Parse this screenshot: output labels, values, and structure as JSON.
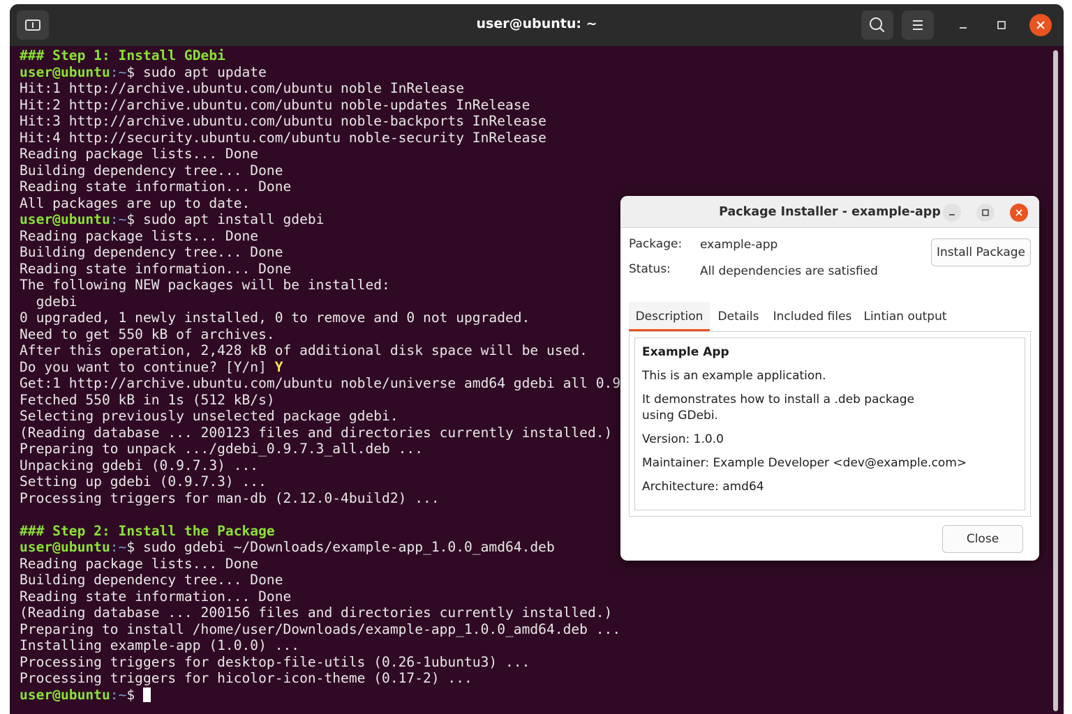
{
  "window": {
    "title": "user@ubuntu: ~",
    "icons": {
      "new_tab": "new-tab-icon",
      "search": "search-icon",
      "menu": "hamburger-menu-icon"
    }
  },
  "colors": {
    "terminal_bg": "#300a24",
    "prompt_user": "#8ae234",
    "prompt_path": "#729fcf",
    "close_accent": "#e95420"
  },
  "terminal": {
    "lines": [
      {
        "t": "heading",
        "text": "### Step 1: Install GDebi"
      },
      {
        "t": "prompt",
        "user": "user@ubuntu",
        "path": ":~",
        "cmd": "$ sudo apt update"
      },
      {
        "t": "out",
        "text": "Hit:1 http://archive.ubuntu.com/ubuntu noble InRelease"
      },
      {
        "t": "out",
        "text": "Hit:2 http://archive.ubuntu.com/ubuntu noble-updates InRelease"
      },
      {
        "t": "out",
        "text": "Hit:3 http://archive.ubuntu.com/ubuntu noble-backports InRelease"
      },
      {
        "t": "out",
        "text": "Hit:4 http://security.ubuntu.com/ubuntu noble-security InRelease"
      },
      {
        "t": "out",
        "text": "Reading package lists... Done"
      },
      {
        "t": "out",
        "text": "Building dependency tree... Done"
      },
      {
        "t": "out",
        "text": "Reading state information... Done"
      },
      {
        "t": "out",
        "text": "All packages are up to date."
      },
      {
        "t": "prompt",
        "user": "user@ubuntu",
        "path": ":~",
        "cmd": "$ sudo apt install gdebi"
      },
      {
        "t": "out",
        "text": "Reading package lists... Done"
      },
      {
        "t": "out",
        "text": "Building dependency tree... Done"
      },
      {
        "t": "out",
        "text": "Reading state information... Done"
      },
      {
        "t": "out",
        "text": "The following NEW packages will be installed:"
      },
      {
        "t": "out",
        "text": "  gdebi"
      },
      {
        "t": "out",
        "text": "0 upgraded, 1 newly installed, 0 to remove and 0 not upgraded."
      },
      {
        "t": "out",
        "text": "Need to get 550 kB of archives."
      },
      {
        "t": "out",
        "text": "After this operation, 2,428 kB of additional disk space will be used."
      },
      {
        "t": "yn",
        "text": "Do you want to continue? [Y/n] ",
        "answer": "Y"
      },
      {
        "t": "out",
        "text": "Get:1 http://archive.ubuntu.com/ubuntu noble/universe amd64 gdebi all 0.9.7.3 [550 kB]"
      },
      {
        "t": "out",
        "text": "Fetched 550 kB in 1s (512 kB/s)"
      },
      {
        "t": "out",
        "text": "Selecting previously unselected package gdebi."
      },
      {
        "t": "out",
        "text": "(Reading database ... 200123 files and directories currently installed.)"
      },
      {
        "t": "out",
        "text": "Preparing to unpack .../gdebi_0.9.7.3_all.deb ..."
      },
      {
        "t": "out",
        "text": "Unpacking gdebi (0.9.7.3) ..."
      },
      {
        "t": "out",
        "text": "Setting up gdebi (0.9.7.3) ..."
      },
      {
        "t": "out",
        "text": "Processing triggers for man-db (2.12.0-4build2) ..."
      },
      {
        "t": "out",
        "text": ""
      },
      {
        "t": "heading",
        "text": "### Step 2: Install the Package"
      },
      {
        "t": "prompt",
        "user": "user@ubuntu",
        "path": ":~",
        "cmd": "$ sudo gdebi ~/Downloads/example-app_1.0.0_amd64.deb"
      },
      {
        "t": "out",
        "text": "Reading package lists... Done"
      },
      {
        "t": "out",
        "text": "Building dependency tree... Done"
      },
      {
        "t": "out",
        "text": "Reading state information... Done"
      },
      {
        "t": "out",
        "text": "(Reading database ... 200156 files and directories currently installed.)"
      },
      {
        "t": "out",
        "text": "Preparing to install /home/user/Downloads/example-app_1.0.0_amd64.deb ..."
      },
      {
        "t": "out",
        "text": "Installing example-app (1.0.0) ..."
      },
      {
        "t": "out",
        "text": "Processing triggers for desktop-file-utils (0.26-1ubuntu3) ..."
      },
      {
        "t": "out",
        "text": "Processing triggers for hicolor-icon-theme (0.17-2) ..."
      },
      {
        "t": "cursorprompt",
        "user": "user@ubuntu",
        "path": ":~",
        "cmd": "$ "
      }
    ]
  },
  "dialog": {
    "title": "Package Installer - example-app",
    "package_label": "Package:",
    "package_value": "example-app",
    "status_label": "Status:",
    "status_value": "All dependencies are satisfied",
    "install_button": "Install Package",
    "tabs": [
      "Description",
      "Details",
      "Included files",
      "Lintian output"
    ],
    "active_tab": "Description",
    "content": {
      "name": "Example App",
      "summary": "This is an example application.",
      "desc1": "It demonstrates how to install a .deb package",
      "desc2": "using GDebi.",
      "version": "Version: 1.0.0",
      "maintainer": "Maintainer: Example Developer <dev@example.com>",
      "architecture": "Architecture: amd64"
    },
    "close_button": "Close"
  }
}
